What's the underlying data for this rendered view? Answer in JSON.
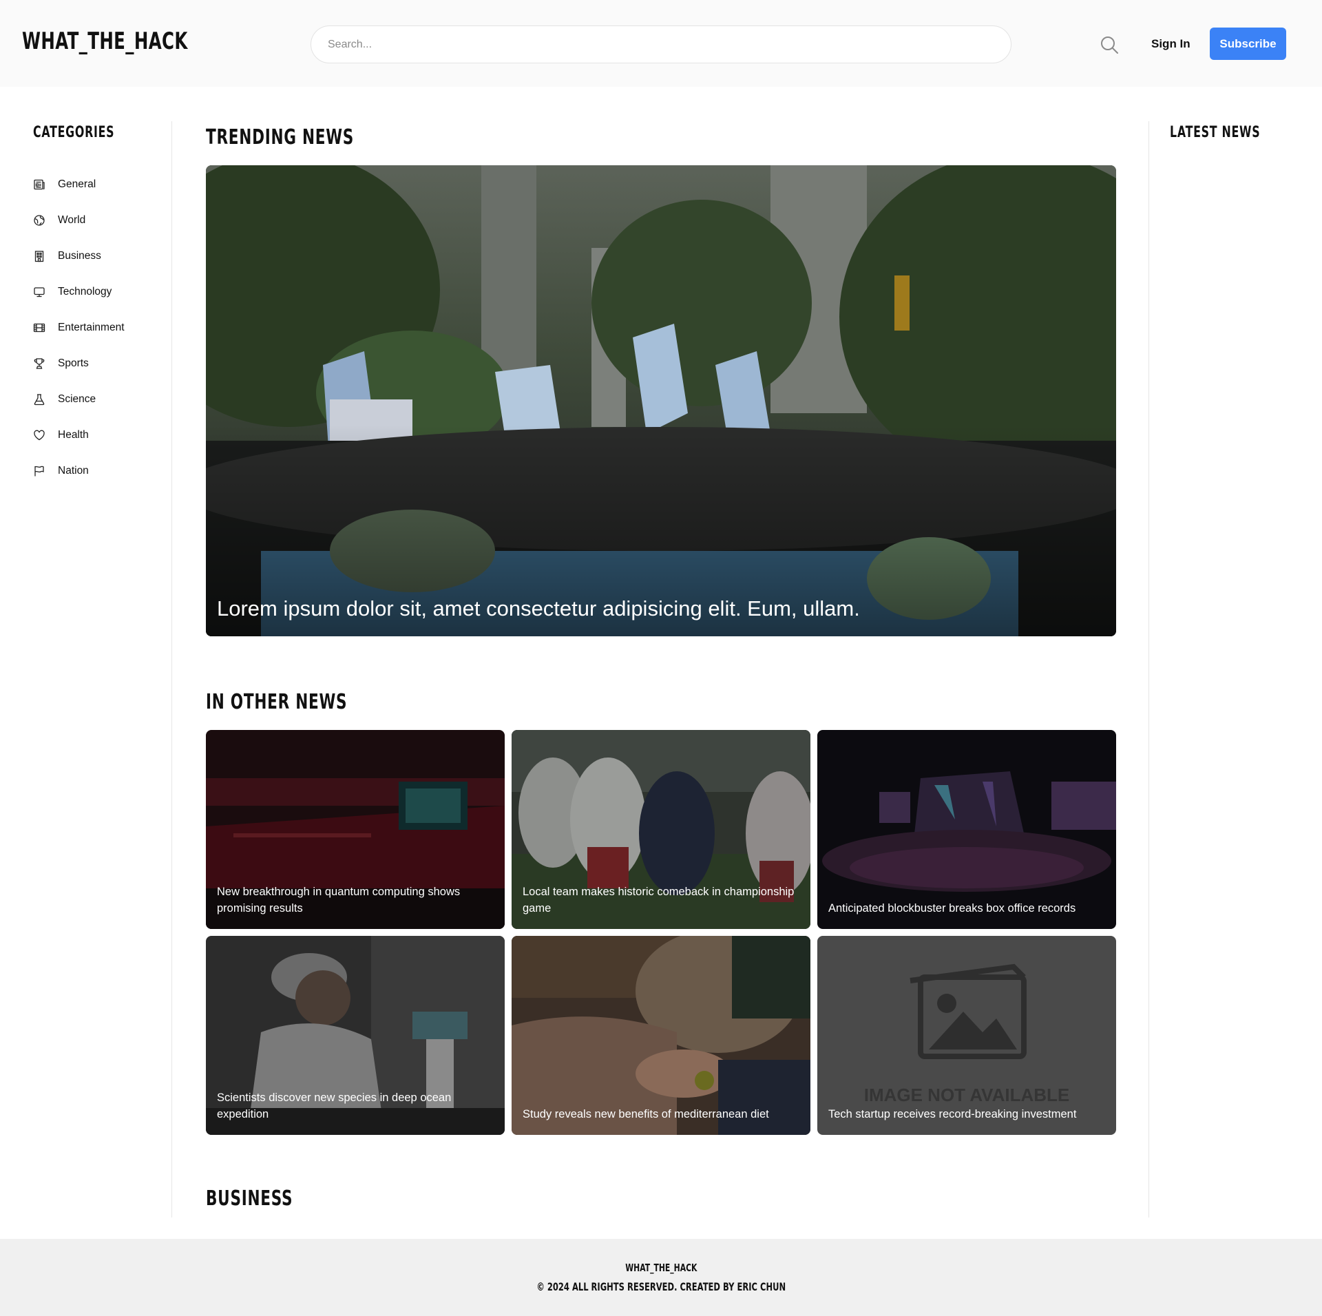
{
  "header": {
    "logo": "WHAT_THE_HACK",
    "search_placeholder": "Search...",
    "signin_label": "Sign In",
    "subscribe_label": "Subscribe",
    "accent_color": "#3b82f6"
  },
  "sidebar": {
    "title": "CATEGORIES",
    "items": [
      {
        "label": "General",
        "icon": "newspaper-icon"
      },
      {
        "label": "World",
        "icon": "globe-icon"
      },
      {
        "label": "Business",
        "icon": "building-icon"
      },
      {
        "label": "Technology",
        "icon": "monitor-icon"
      },
      {
        "label": "Entertainment",
        "icon": "film-icon"
      },
      {
        "label": "Sports",
        "icon": "trophy-icon"
      },
      {
        "label": "Science",
        "icon": "flask-icon"
      },
      {
        "label": "Health",
        "icon": "heart-icon"
      },
      {
        "label": "Nation",
        "icon": "flag-icon"
      }
    ]
  },
  "main": {
    "trending_title": "TRENDING NEWS",
    "hero_title": "Lorem ipsum dolor sit, amet consectetur adipisicing elit. Eum, ullam.",
    "other_title": "IN OTHER NEWS",
    "cards": [
      {
        "title": "New breakthrough in quantum computing shows promising results"
      },
      {
        "title": "Local team makes historic comeback in championship game"
      },
      {
        "title": "Anticipated blockbuster breaks box office records"
      },
      {
        "title": "Scientists discover new species in deep ocean expedition"
      },
      {
        "title": "Study reveals new benefits of mediterranean diet"
      },
      {
        "title": "Tech startup receives record-breaking investment",
        "placeholder_text": "IMAGE NOT AVAILABLE"
      }
    ],
    "business_title": "BUSINESS"
  },
  "rightcol": {
    "title": "LATEST NEWS"
  },
  "footer": {
    "brand": "WHAT_THE_HACK",
    "copyright": "© 2024 ALL RIGHTS RESERVED. CREATED BY ERIC CHUN"
  }
}
